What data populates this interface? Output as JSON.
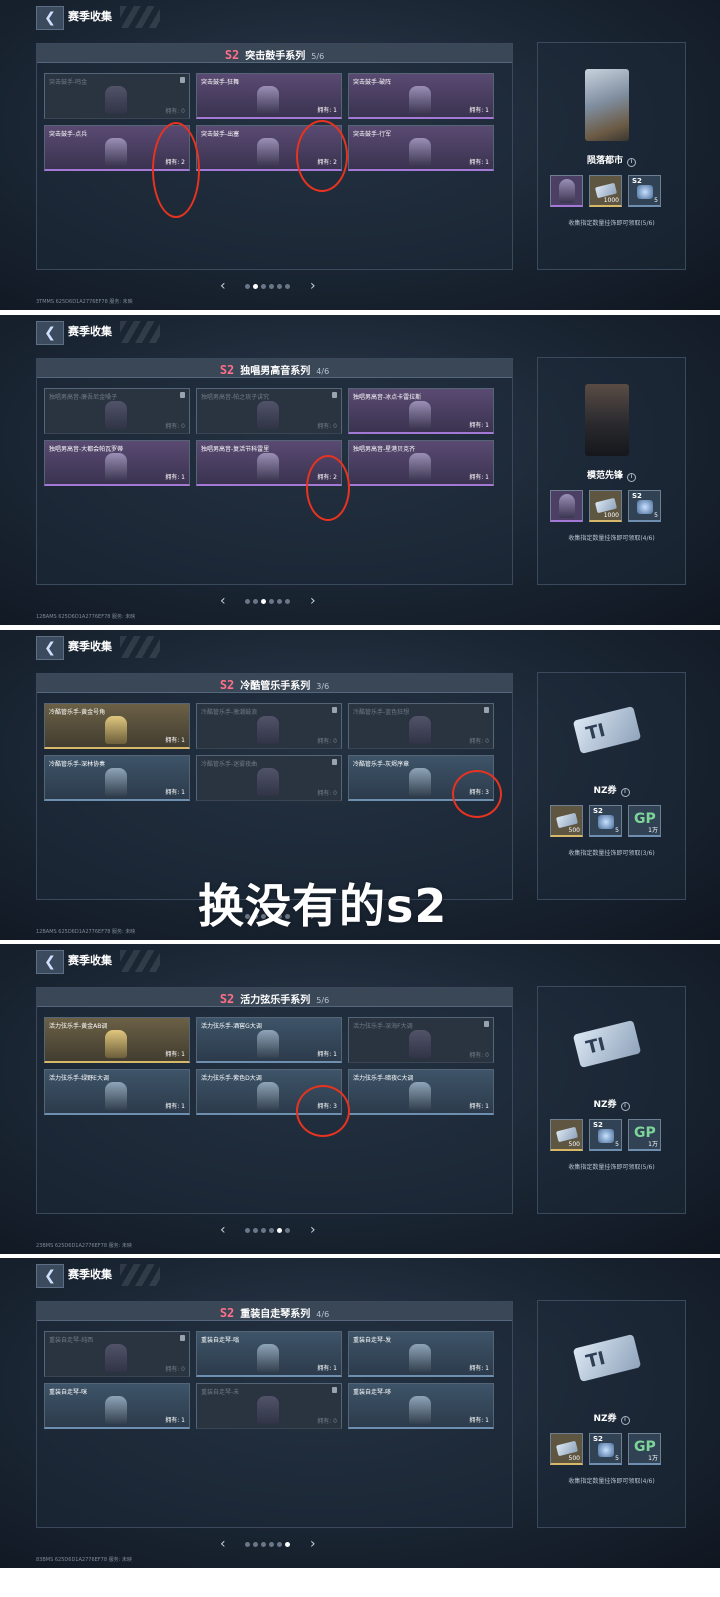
{
  "header_title": "赛季收集",
  "s2_label": "S2",
  "panels": [
    {
      "series": "突击鼓手系列",
      "progress": "5/6",
      "items": [
        {
          "name": "突击鼓手-鸣金",
          "own": "拥有: 0",
          "style": "locked"
        },
        {
          "name": "突击鼓手-狂舞",
          "own": "拥有: 1",
          "style": "purple"
        },
        {
          "name": "突击鼓手-破阵",
          "own": "拥有: 1",
          "style": "purple"
        },
        {
          "name": "突击鼓手-点兵",
          "own": "拥有: 2",
          "style": "purple"
        },
        {
          "name": "突击鼓手-出塞",
          "own": "拥有: 2",
          "style": "purple"
        },
        {
          "name": "突击鼓手-行军",
          "own": "拥有: 1",
          "style": "purple"
        }
      ],
      "reward_name": "陨落都市",
      "reward_art": "city",
      "slots": [
        {
          "type": "purple",
          "tag": "",
          "num": "",
          "art": "figure"
        },
        {
          "type": "gold",
          "tag": "",
          "num": "1000",
          "art": "ticket"
        },
        {
          "type": "blue",
          "tag": "S2",
          "num": "5",
          "art": "chip"
        }
      ],
      "note": "收集指定数量挂饰即可领取(5/6)",
      "active_page": 1,
      "footer": "3TMMS  625D6D1A2776EF78    服务: 未映"
    },
    {
      "series": "独唱男高音系列",
      "progress": "4/6",
      "items": [
        {
          "name": "独唱男高音-廉吾尼金嗓子",
          "own": "拥有: 0",
          "style": "locked"
        },
        {
          "name": "独唱男高音-帕之琉子讲究",
          "own": "拥有: 0",
          "style": "locked"
        },
        {
          "name": "独唱男高音-冰点卡雷拉斯",
          "own": "拥有: 1",
          "style": "purple"
        },
        {
          "name": "独唱男高音-大都会帕瓦罗蒂",
          "own": "拥有: 1",
          "style": "purple"
        },
        {
          "name": "独唱男高音-复活节科雷里",
          "own": "拥有: 2",
          "style": "purple"
        },
        {
          "name": "独唱男高音-星港贝克齐",
          "own": "拥有: 1",
          "style": "purple"
        }
      ],
      "reward_name": "模范先锋",
      "reward_art": "soldier",
      "slots": [
        {
          "type": "purple",
          "tag": "",
          "num": "",
          "art": "figure"
        },
        {
          "type": "gold",
          "tag": "",
          "num": "1000",
          "art": "ticket"
        },
        {
          "type": "blue",
          "tag": "S2",
          "num": "5",
          "art": "chip"
        }
      ],
      "note": "收集指定数量挂饰即可领取(4/6)",
      "active_page": 2,
      "footer": "12BAMS  625D6D1A2776EF78    服务: 未映"
    },
    {
      "series": "冷酷管乐手系列",
      "progress": "3/6",
      "items": [
        {
          "name": "冷酷管乐手-黄金号角",
          "own": "拥有: 1",
          "style": "gold"
        },
        {
          "name": "冷酷管乐手-激潮鼓浪",
          "own": "拥有: 0",
          "style": "locked"
        },
        {
          "name": "冷酷管乐手-蓝色狂想",
          "own": "拥有: 0",
          "style": "locked"
        },
        {
          "name": "冷酷管乐手-深林协奏",
          "own": "拥有: 1",
          "style": "blue"
        },
        {
          "name": "冷酷管乐手-迷雾夜曲",
          "own": "拥有: 0",
          "style": "locked"
        },
        {
          "name": "冷酷管乐手-灰烬序章",
          "own": "拥有: 3",
          "style": "blue"
        }
      ],
      "reward_name": "NZ券",
      "reward_art": "ticket",
      "slots": [
        {
          "type": "gold",
          "tag": "",
          "num": "500",
          "art": "ticket"
        },
        {
          "type": "blue",
          "tag": "S2",
          "num": "5",
          "art": "chip"
        },
        {
          "type": "blue",
          "tag": "",
          "num": "1万",
          "art": "gp"
        }
      ],
      "note": "收集指定数量挂饰即可领取(3/6)",
      "active_page": 3,
      "footer": "12BAMS  625D6D1A2776EF78    服务: 未映"
    },
    {
      "series": "活力弦乐手系列",
      "progress": "5/6",
      "items": [
        {
          "name": "活力弦乐手-黄金AB调",
          "own": "拥有: 1",
          "style": "gold"
        },
        {
          "name": "活力弦乐手-酒窖G大调",
          "own": "拥有: 1",
          "style": "blue"
        },
        {
          "name": "活力弦乐手-深海F大调",
          "own": "拥有: 0",
          "style": "locked"
        },
        {
          "name": "活力弦乐手-绿野E大调",
          "own": "拥有: 1",
          "style": "blue"
        },
        {
          "name": "活力弦乐手-紫色D大调",
          "own": "拥有: 3",
          "style": "blue"
        },
        {
          "name": "活力弦乐手-暗夜C大调",
          "own": "拥有: 1",
          "style": "blue"
        }
      ],
      "reward_name": "NZ券",
      "reward_art": "ticket",
      "slots": [
        {
          "type": "gold",
          "tag": "",
          "num": "500",
          "art": "ticket"
        },
        {
          "type": "blue",
          "tag": "S2",
          "num": "5",
          "art": "chip"
        },
        {
          "type": "blue",
          "tag": "",
          "num": "1万",
          "art": "gp"
        }
      ],
      "note": "收集指定数量挂饰即可领取(5/6)",
      "active_page": 4,
      "footer": "23BMS  625D6D1A2776EF78    服务: 未映"
    },
    {
      "series": "重装自走琴系列",
      "progress": "4/6",
      "items": [
        {
          "name": "重装自走琴-纯西",
          "own": "拥有: 0",
          "style": "locked"
        },
        {
          "name": "重装自走琴-嗡",
          "own": "拥有: 1",
          "style": "blue"
        },
        {
          "name": "重装自走琴-发",
          "own": "拥有: 1",
          "style": "blue"
        },
        {
          "name": "重装自走琴-咪",
          "own": "拥有: 1",
          "style": "blue"
        },
        {
          "name": "重装自走琴-未",
          "own": "拥有: 0",
          "style": "locked"
        },
        {
          "name": "重装自走琴-哆",
          "own": "拥有: 1",
          "style": "blue"
        }
      ],
      "reward_name": "NZ券",
      "reward_art": "ticket",
      "slots": [
        {
          "type": "gold",
          "tag": "",
          "num": "500",
          "art": "ticket"
        },
        {
          "type": "blue",
          "tag": "S2",
          "num": "5",
          "art": "chip"
        },
        {
          "type": "blue",
          "tag": "",
          "num": "1万",
          "art": "gp"
        }
      ],
      "note": "收集指定数量挂饰即可领取(4/6)",
      "active_page": 5,
      "footer": "83BMS  625D6D1A2776EF78    服务: 未映"
    }
  ],
  "overlay_text": "换没有的s2",
  "annotation_color": "#e7331f"
}
